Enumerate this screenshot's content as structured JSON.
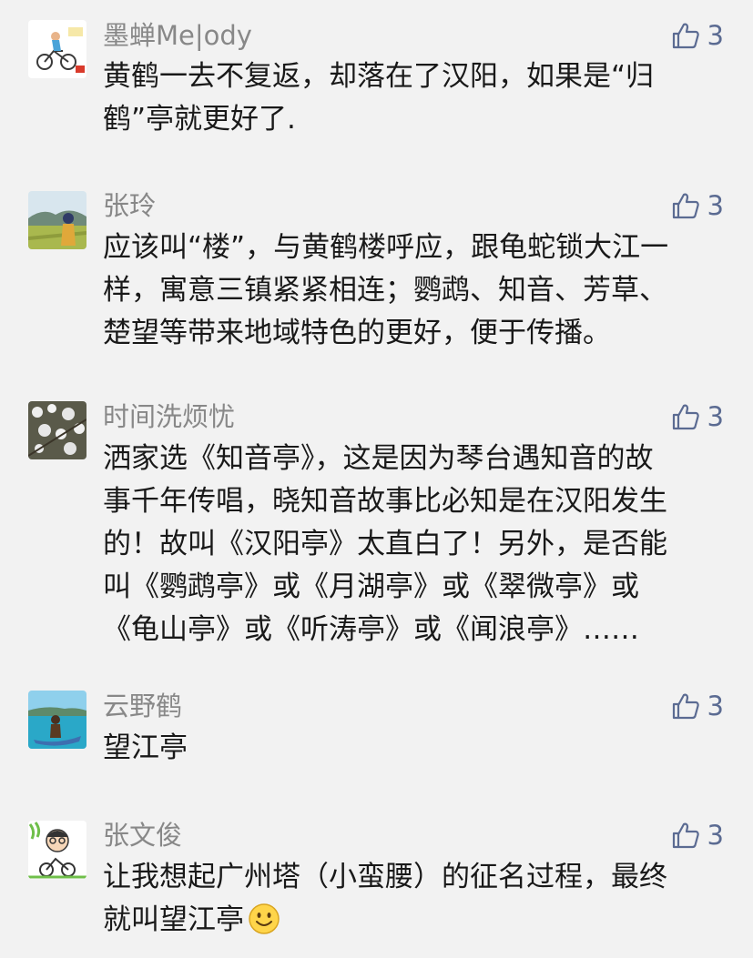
{
  "colors": {
    "background": "#f2f2f2",
    "name": "#888888",
    "text": "#191919",
    "like": "#5b6b92"
  },
  "comments": [
    {
      "name": "墨蝉Me|ody",
      "likes": "3",
      "text": "黄鹤一去不复返，却落在了汉阳，如果是“归\n鹤”亭就更好了.",
      "avatar_icon": "cyclist-avatar"
    },
    {
      "name": "张玲",
      "likes": "3",
      "text": "应该叫“楼”，与黄鹤楼呼应，跟龟蛇锁大江一\n样，寓意三镇紧紧相连；鹦鹉、知音、芳草、\n楚望等带来地域特色的更好，便于传播。",
      "avatar_icon": "landscape-avatar"
    },
    {
      "name": "时间洗烦忧",
      "likes": "3",
      "text": "洒家选《知音亭》，这是因为琴台遇知音的故\n事千年传唱，晓知音故事比必知是在汉阳发生\n的！故叫《汉阳亭》太直白了！另外，是否能\n叫《鹦鹉亭》或《月湖亭》或《翠微亭》或\n《龟山亭》或《听涛亭》或《闻浪亭》……",
      "avatar_icon": "blossom-avatar"
    },
    {
      "name": "云野鹤",
      "likes": "3",
      "text": "望江亭",
      "avatar_icon": "sea-boat-avatar"
    },
    {
      "name": "张文俊",
      "likes": "3",
      "text": "让我想起广州塔（小蛮腰）的征名过程，最终\n就叫望江亭",
      "avatar_icon": "cartoon-cyclist-avatar",
      "trailing_icon": "smile-emoji-icon"
    }
  ]
}
